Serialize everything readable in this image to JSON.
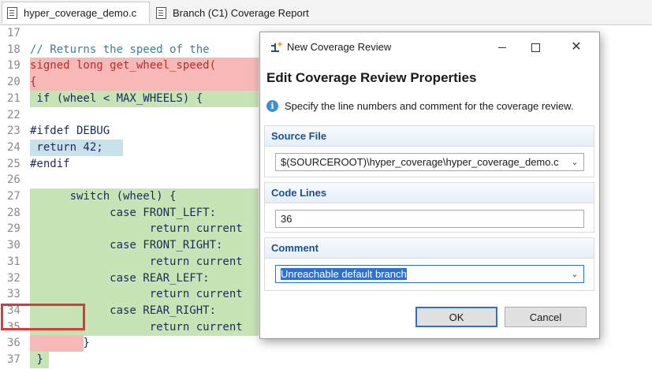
{
  "tabs": [
    {
      "label": "hyper_coverage_demo.c",
      "icon": "source-file-icon",
      "active": true
    },
    {
      "label": "Branch (C1) Coverage Report",
      "icon": "report-icon",
      "active": false
    }
  ],
  "code_lines": [
    {
      "num": "17",
      "text": "",
      "bg": "none"
    },
    {
      "num": "18",
      "text": "// Returns the speed of the",
      "bg": "none"
    },
    {
      "num": "19",
      "text": "signed long get_wheel_speed(",
      "bg": "red"
    },
    {
      "num": "20",
      "text": "{",
      "bg": "red"
    },
    {
      "num": "21",
      "text": " if (wheel < MAX_WHEELS) {",
      "bg": "green"
    },
    {
      "num": "22",
      "text": "",
      "bg": "none"
    },
    {
      "num": "23",
      "text": "#ifdef DEBUG",
      "bg": "none"
    },
    {
      "num": "24",
      "text": " return 42;",
      "bg": "blue"
    },
    {
      "num": "25",
      "text": "#endif",
      "bg": "none"
    },
    {
      "num": "26",
      "text": "",
      "bg": "none"
    },
    {
      "num": "27",
      "text": "      switch (wheel) {",
      "bg": "green"
    },
    {
      "num": "28",
      "text": "            case FRONT_LEFT:",
      "bg": "green"
    },
    {
      "num": "29",
      "text": "                  return current",
      "bg": "green"
    },
    {
      "num": "30",
      "text": "            case FRONT_RIGHT:",
      "bg": "green"
    },
    {
      "num": "31",
      "text": "                  return current",
      "bg": "green"
    },
    {
      "num": "32",
      "text": "            case REAR_LEFT:",
      "bg": "green"
    },
    {
      "num": "33",
      "text": "                  return current",
      "bg": "green"
    },
    {
      "num": "34",
      "text": "            case REAR_RIGHT:",
      "bg": "green"
    },
    {
      "num": "35",
      "text": "                  return current",
      "bg": "green"
    },
    {
      "num": "36",
      "text": "        }",
      "bg": "red"
    },
    {
      "num": "37",
      "text": " }",
      "bg": "green"
    }
  ],
  "dialog": {
    "window_title": "New Coverage Review",
    "heading": "Edit Coverage Review Properties",
    "info_text": "Specify the line numbers and comment for the coverage review.",
    "source_file": {
      "label": "Source File",
      "value": "$(SOURCEROOT)\\hyper_coverage\\hyper_coverage_demo.c"
    },
    "code_lines": {
      "label": "Code Lines",
      "value": "36"
    },
    "comment": {
      "label": "Comment",
      "value": "Unreachable default branch"
    },
    "ok_label": "OK",
    "cancel_label": "Cancel"
  },
  "colors": {
    "covered_green": "#c6e4b6",
    "uncovered_red": "#f8b8b8",
    "partial_blue": "#c8e2ec",
    "highlight_border": "#e0383a",
    "accent": "#2f6fcf"
  }
}
